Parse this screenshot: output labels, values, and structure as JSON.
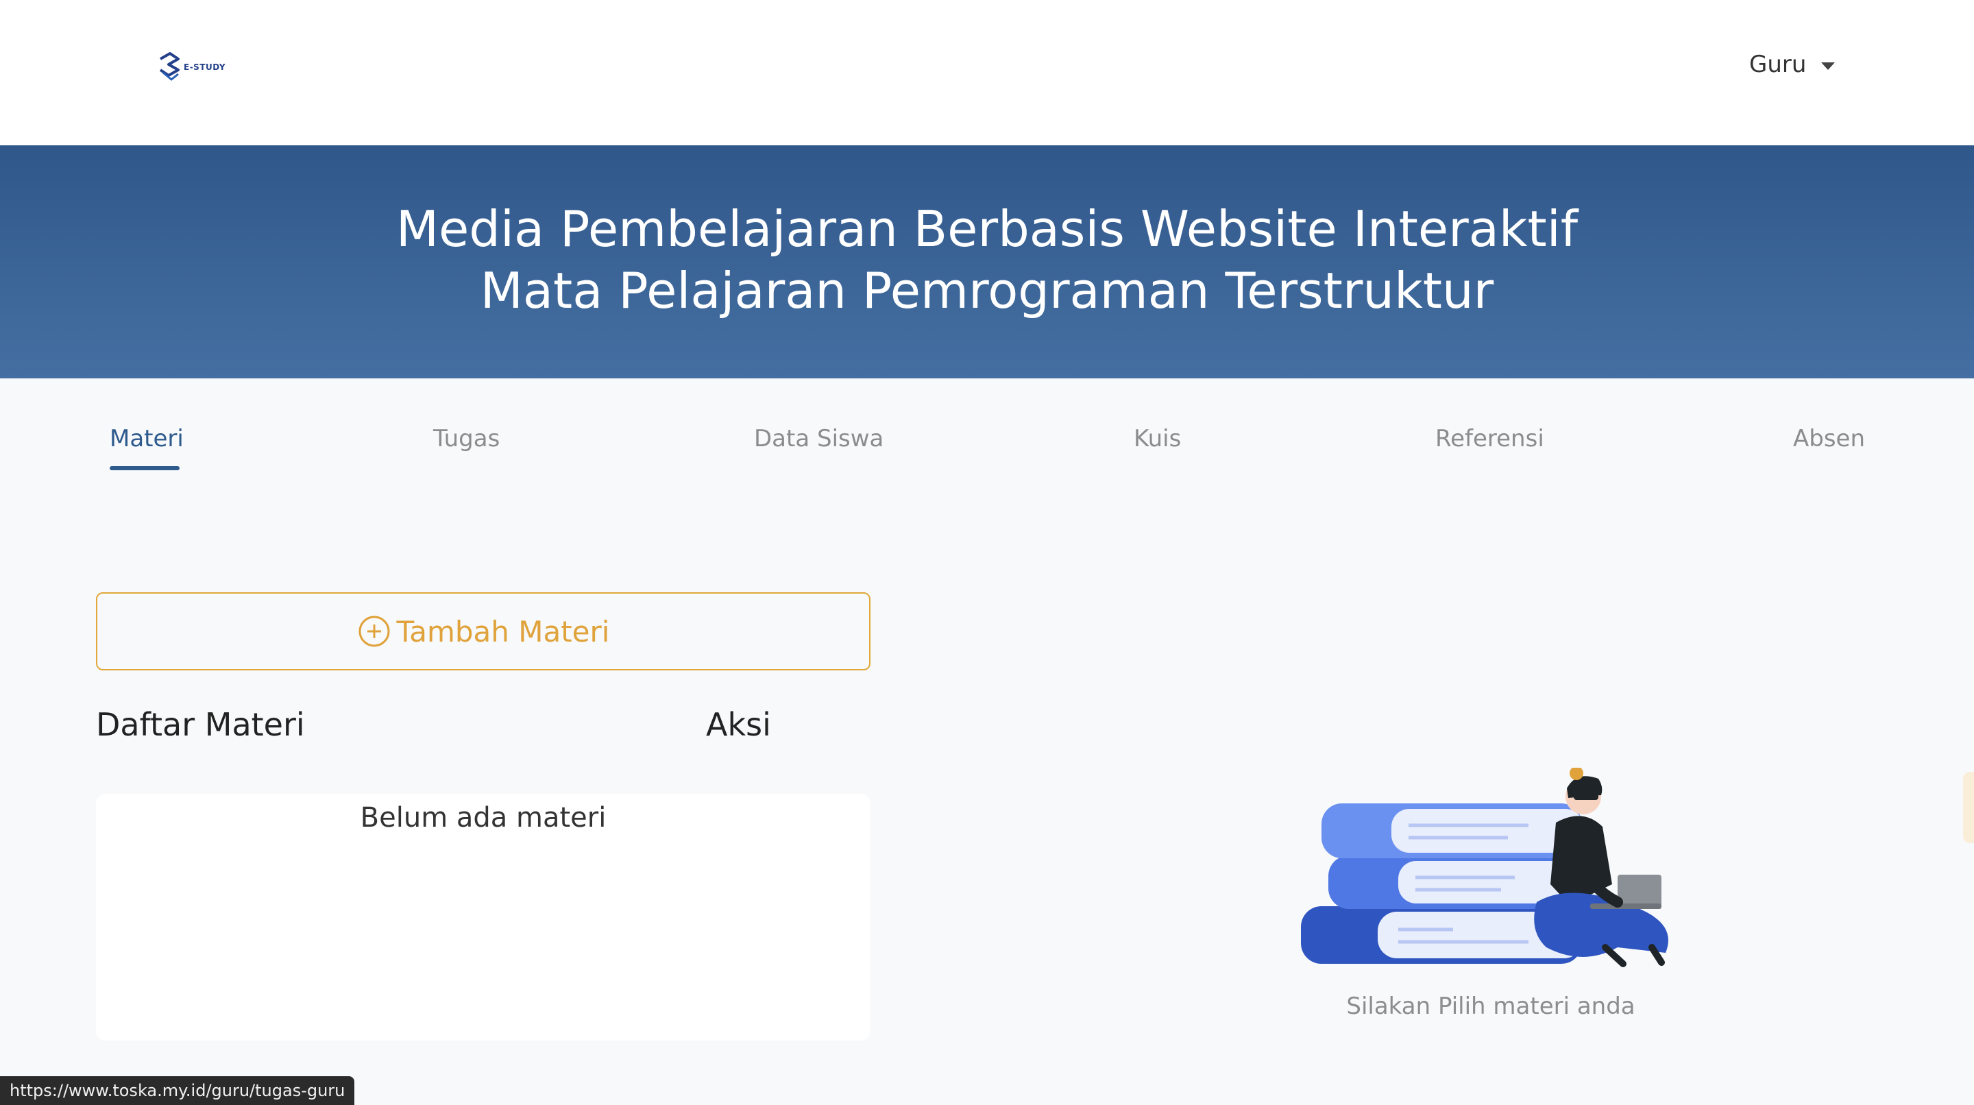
{
  "brand": {
    "name": "E-STUDY"
  },
  "user_menu": {
    "label": "Guru"
  },
  "hero": {
    "title": "Media Pembelajaran Berbasis Website Interaktif Mata Pelajaran Pemrograman Terstruktur"
  },
  "tabs": [
    {
      "label": "Materi",
      "active": true
    },
    {
      "label": "Tugas"
    },
    {
      "label": "Data Siswa"
    },
    {
      "label": "Kuis"
    },
    {
      "label": "Referensi"
    },
    {
      "label": "Absen"
    }
  ],
  "materi": {
    "add_button_label": "Tambah Materi",
    "list_header": "Daftar Materi",
    "action_header": "Aksi",
    "empty_message": "Belum ada materi"
  },
  "preview": {
    "hint": "Silakan Pilih materi anda"
  },
  "status_bar": {
    "url": "https://www.toska.my.id/guru/tugas-guru"
  },
  "colors": {
    "primary": "#2e5a8c",
    "hero_top": "#30578a",
    "hero_bottom": "#456fa2",
    "accent": "#e0a23a",
    "page_bg": "#f7f9fb"
  }
}
